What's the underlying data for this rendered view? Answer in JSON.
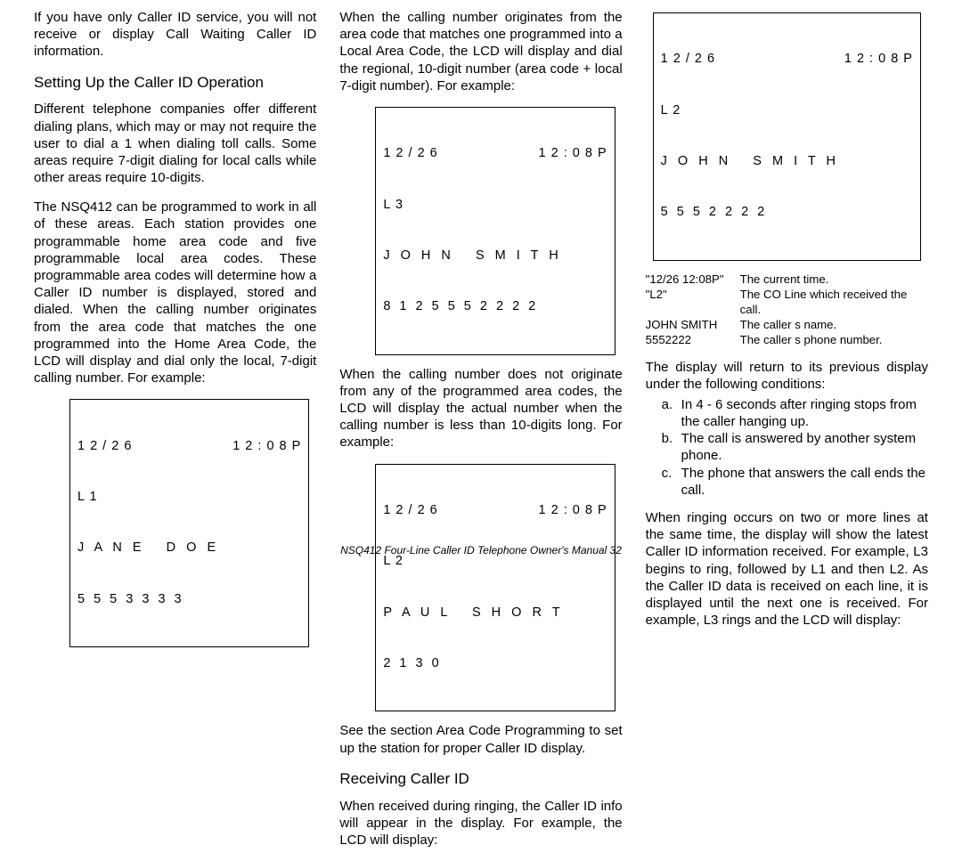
{
  "col1": {
    "p1": "If you have only Caller ID service, you will not receive or display Call Waiting Caller ID information.",
    "h1": "Setting Up the Caller ID Operation",
    "p2": "Different telephone companies offer different dialing plans, which may or may not require the user to dial a  1  when dialing toll calls. Some areas require 7-digit dialing for local calls while other areas require 10-digits.",
    "p3": "The NSQ412 can be programmed to work in all of these areas. Each station provides one programmable home area code and five programmable local area codes. These programmable area codes will determine how a Caller ID number is displayed, stored and dialed. When the calling number originates from the area code that matches the one programmed into the Home Area Code, the LCD will display and dial only the local, 7-digit calling number. For example:",
    "lcd1": {
      "date": "1 2 / 2 6",
      "time": "1 2 : 0 8 P",
      "line": "L 1",
      "name": "J A N E   D O E",
      "num": "5 5 5 3 3 3 3"
    }
  },
  "col2": {
    "p1": "When the calling number originates from the area code that matches one programmed into a Local Area Code, the LCD will display and dial the regional, 10-digit number (area code + local 7-digit number). For example:",
    "lcd1": {
      "date": "1 2 / 2 6",
      "time": "1 2 : 0 8 P",
      "line": "L 3",
      "name": "J O H N   S M I T H",
      "num": "8 1 2 5 5 5 2 2 2 2"
    },
    "p2": "When the calling number does not originate from any of the programmed area codes, the LCD will display the actual number when the calling number is less than 10-digits long. For example:",
    "lcd2": {
      "date": "1 2 / 2 6",
      "time": "1 2 : 0 8 P",
      "line": "L 2",
      "name": "P A U L   S H O R T",
      "num": "2 1 3 0"
    },
    "p3": "See the section Area Code Programming to set up the station for proper Caller ID display.",
    "h1": "Receiving Caller ID",
    "p4": "When received during ringing, the Caller ID info will appear in the display. For example, the LCD will display:"
  },
  "col3": {
    "lcd1": {
      "date": "1 2 / 2 6",
      "time": "1 2 : 0 8 P",
      "line": "L 2",
      "name": "J O H N   S M I T H",
      "num": "5 5 5 2 2 2 2"
    },
    "def": {
      "k1": "\"12/26 12:08P\"",
      "v1": "The current time.",
      "k2": "\"L2\"",
      "v2": "The CO Line which received the call.",
      "k3": "JOHN SMITH",
      "v3": "The caller s name.",
      "k4": "5552222",
      "v4": "The caller s phone number."
    },
    "p1": "The display will return to its previous display under the following conditions:",
    "li": {
      "a": "In 4 - 6 seconds after ringing stops from the caller hanging up.",
      "b": "The call is answered by another system phone.",
      "c": "The phone that answers the call ends the call."
    },
    "p2": "When ringing occurs on two or more lines at the same time, the display will show the latest Caller ID information received. For example, L3 begins to ring, followed by L1 and then L2. As the Caller ID data is received on each line, it is displayed until the next one is received. For example, L3 rings and the LCD will display:"
  },
  "footer": "NSQ412 Four-Line Caller ID Telephone Owner's Manual    32"
}
